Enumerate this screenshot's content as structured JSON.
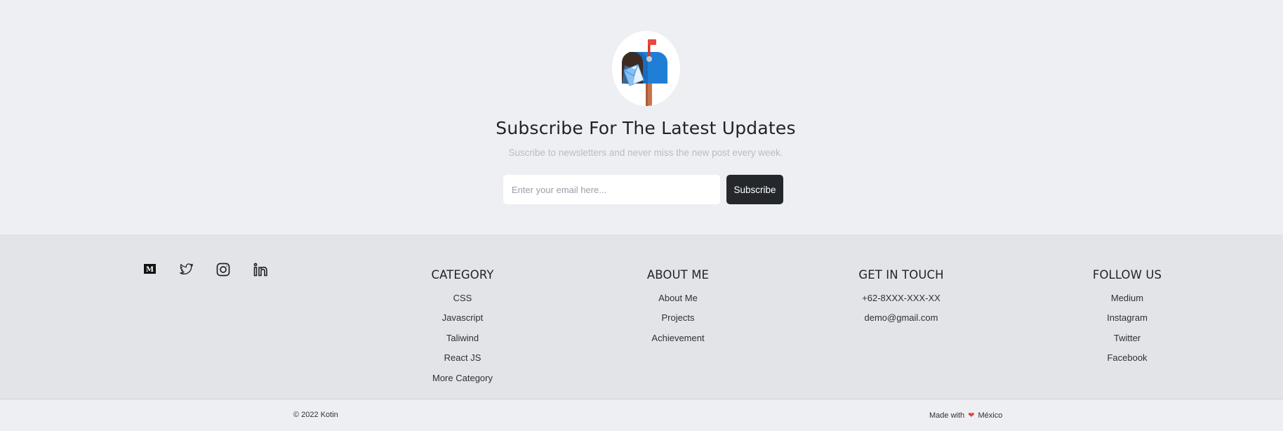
{
  "newsletter": {
    "title": "Subscribe For The Latest Updates",
    "subtitle": "Suscribe to newsletters and never miss the new post every week.",
    "email_placeholder": "Enter your email here...",
    "email_value": "",
    "subscribe_label": "Subscribe",
    "icon": "mailbox-icon"
  },
  "footer": {
    "social": [
      {
        "name": "medium",
        "icon": "medium-icon"
      },
      {
        "name": "twitter",
        "icon": "twitter-icon"
      },
      {
        "name": "instagram",
        "icon": "instagram-icon"
      },
      {
        "name": "linkedin",
        "icon": "linkedin-icon"
      }
    ],
    "columns": [
      {
        "title": "CATEGORY",
        "items": [
          "CSS",
          "Javascript",
          "Taliwind",
          "React JS",
          "More Category"
        ]
      },
      {
        "title": "ABOUT ME",
        "items": [
          "About Me",
          "Projects",
          "Achievement"
        ]
      },
      {
        "title": "GET IN TOUCH",
        "items": [
          "+62-8XXX-XXX-XX",
          "demo@gmail.com"
        ]
      },
      {
        "title": "FOLLOW US",
        "items": [
          "Medium",
          "Instagram",
          "Twitter",
          "Facebook"
        ]
      }
    ]
  },
  "bottombar": {
    "copyright": "© 2022 Kotin",
    "made_with_prefix": "Made with",
    "made_with_suffix": "México",
    "heart_color": "#e0463a"
  },
  "colors": {
    "background": "#eeeff3",
    "footer_background": "#e3e4e8",
    "button_background": "#24272c",
    "text": "#1f2227"
  }
}
